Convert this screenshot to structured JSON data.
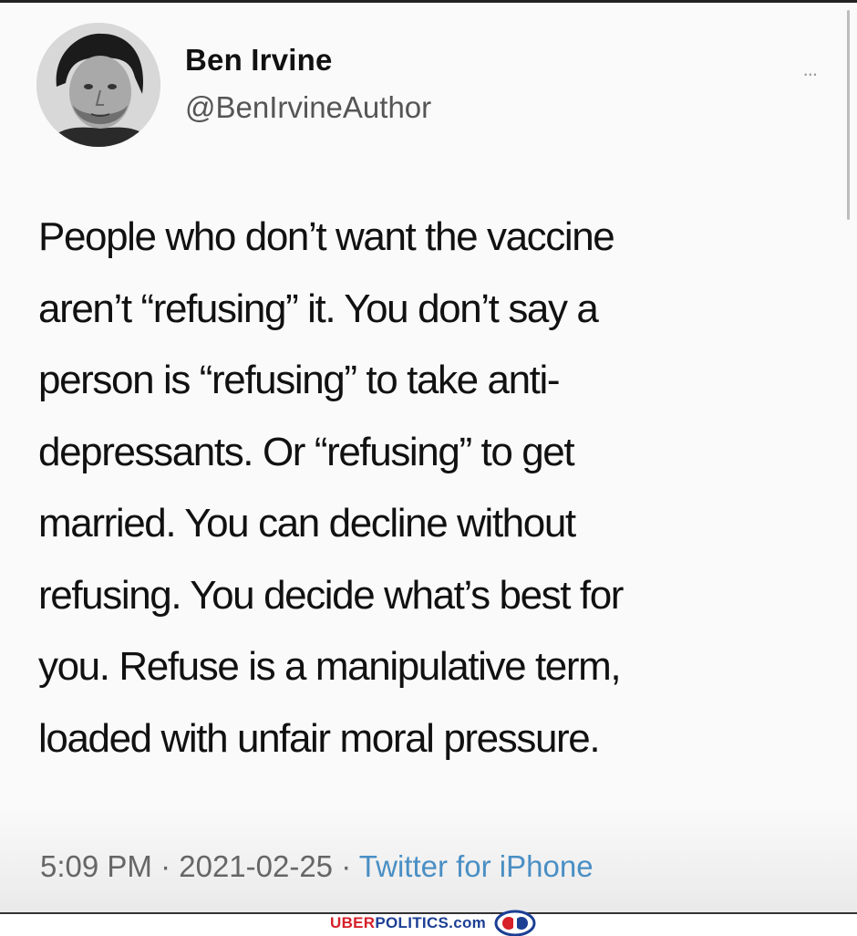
{
  "author": {
    "name": "Ben Irvine",
    "handle": "@BenIrvineAuthor"
  },
  "more_menu_label": "...",
  "tweet": {
    "lines": [
      "People who don’t want the vaccine",
      "aren’t “refusing” it. You don’t say a",
      "person is “refusing” to take anti-",
      "depressants. Or “refusing” to get",
      "married. You can decline without",
      "refusing. You decide what’s best for",
      "you. Refuse is a manipulative term,",
      "loaded with unfair moral pressure."
    ]
  },
  "meta": {
    "time": "5:09 PM",
    "separator": " · ",
    "date": "2021-02-25",
    "source": "Twitter for iPhone"
  },
  "watermark": {
    "part1": "UBER",
    "part2": "POLITICS.com",
    "red": "#d6202a",
    "blue": "#1c3f94"
  },
  "icons": {
    "avatar": "profile-photo",
    "more": "more-options-icon",
    "logo": "elephant-donkey-logo"
  }
}
